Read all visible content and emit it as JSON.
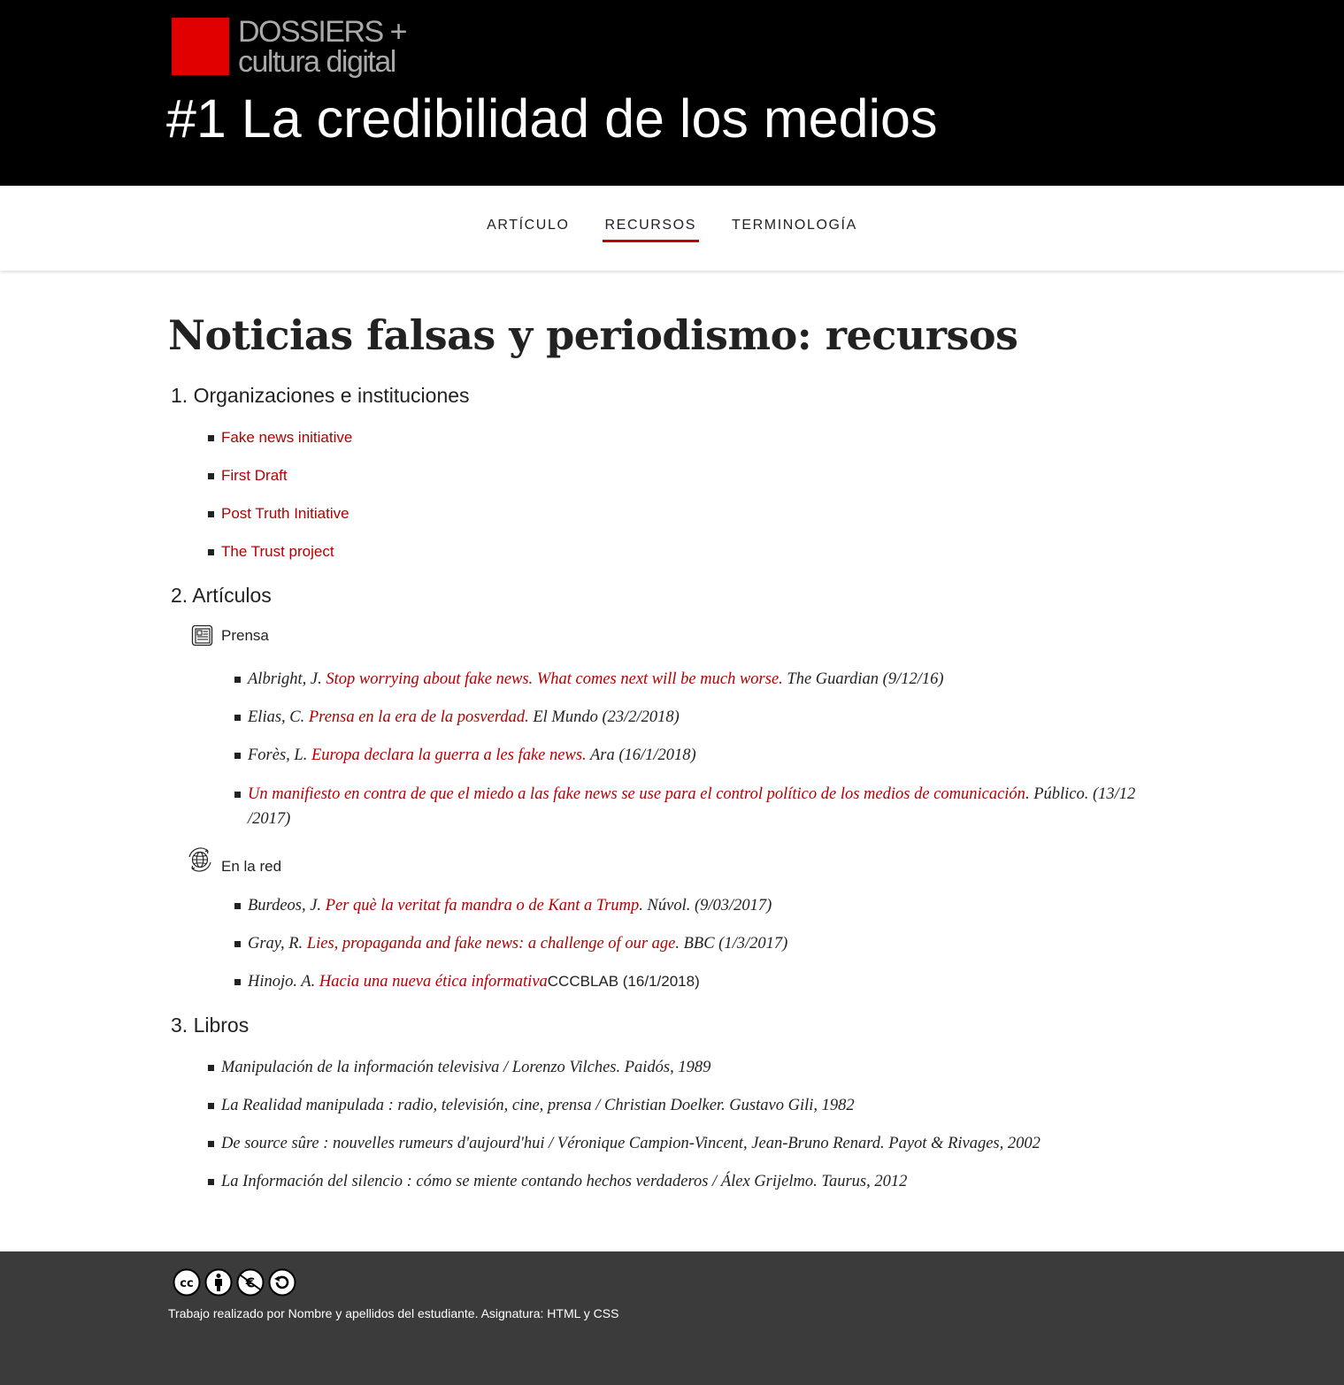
{
  "header": {
    "logo_line1": "DOSSIERS +",
    "logo_line2": "cultura digital",
    "title": "#1 La credibilidad de los medios"
  },
  "nav": {
    "items": [
      {
        "label": "ARTÍCULO"
      },
      {
        "label": "RECURSOS",
        "active": true
      },
      {
        "label": "TERMINOLOGÍA"
      }
    ]
  },
  "main": {
    "title": "Noticias falsas y periodismo: recursos",
    "sections": [
      {
        "heading": "1. Organizaciones e instituciones",
        "items": [
          "Fake news initiative",
          "First Draft",
          "Post Truth Initiative",
          "The Trust project"
        ]
      },
      {
        "heading": "2. Artículos",
        "prensa": {
          "label": "Prensa",
          "items": [
            {
              "author": "Albright, J. ",
              "link": "Stop worrying about fake news. What comes next will be much worse.",
              "source": " The Guardian (9/12/16)"
            },
            {
              "author": "Elias, C. ",
              "link": "Prensa en la era de la posverdad.",
              "source": " El Mundo (23/2/2018)"
            },
            {
              "author": "Forès, L. ",
              "link": "Europa declara la guerra a les fake news.",
              "source": " Ara (16/1/2018)"
            },
            {
              "author": "",
              "link": "Un manifiesto en contra de que el miedo a las fake news se use para el control político de los medios de comunicación",
              "source": ". Público. (13/12",
              "source_line2": "/2017)"
            }
          ]
        },
        "red": {
          "label": "En la red",
          "items": [
            {
              "author": "Burdeos, J. ",
              "link": "Per què la veritat fa mandra o de Kant a Trump",
              "source": ". Núvol. (9/03/2017)"
            },
            {
              "author": "Gray, R. ",
              "link": "Lies, propaganda and fake news: a challenge of our age",
              "source": ". BBC (1/3/2017)"
            },
            {
              "author": "Hinojo. A. ",
              "link": "Hacia una nueva ética informativa",
              "source_plain": "CCCBLAB (16/1/2018)"
            }
          ]
        }
      },
      {
        "heading": "3. Libros",
        "items": [
          "Manipulación de la información televisiva / Lorenzo Vilches. Paidós, 1989",
          "La Realidad manipulada : radio, televisión, cine, prensa / Christian Doelker. Gustavo Gili, 1982",
          "De source sûre : nouvelles rumeurs d'aujourd'hui / Véronique Campion-Vincent, Jean-Bruno Renard. Payot & Rivages, 2002",
          "La Información del silencio : cómo se miente contando hechos verdaderos / Álex Grijelmo. Taurus, 2012"
        ]
      }
    ]
  },
  "footer": {
    "text": "Trabajo realizado por Nombre y apellidos del estudiante. Asignatura: HTML y CSS",
    "icons": [
      "cc-icon",
      "by-icon",
      "nc-eu-icon",
      "sa-icon"
    ]
  },
  "colors": {
    "accent": "#c00000",
    "link": "#b30000",
    "header_bg": "#000000",
    "footer_bg": "#3b3b3b",
    "logo_red": "#e00000"
  }
}
